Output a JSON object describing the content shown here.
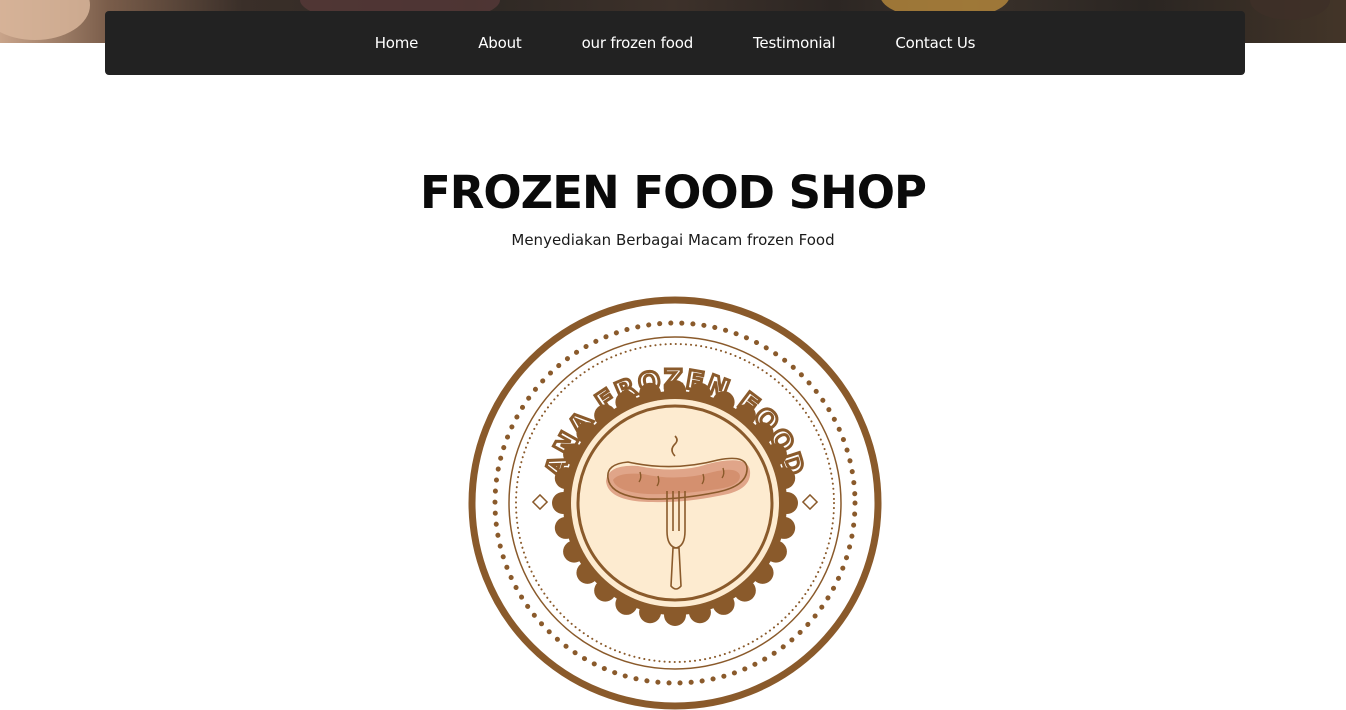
{
  "nav": {
    "items": [
      {
        "label": "Home"
      },
      {
        "label": "About"
      },
      {
        "label": "our frozen food"
      },
      {
        "label": "Testimonial"
      },
      {
        "label": "Contact Us"
      }
    ]
  },
  "hero": {
    "title": "FROZEN FOOD SHOP",
    "subtitle": "Menyediakan Berbagai Macam frozen Food"
  },
  "logo": {
    "text": "ANA FROZEN FOOD",
    "icon": "sausage-fork-icon",
    "colors": {
      "brown": "#8a5a2b",
      "cream": "#fdebd0",
      "sausage": "#e0a589"
    }
  },
  "colors": {
    "navbar_bg": "#222222",
    "nav_text": "#ffffff",
    "title_text": "#0a0a0a"
  }
}
